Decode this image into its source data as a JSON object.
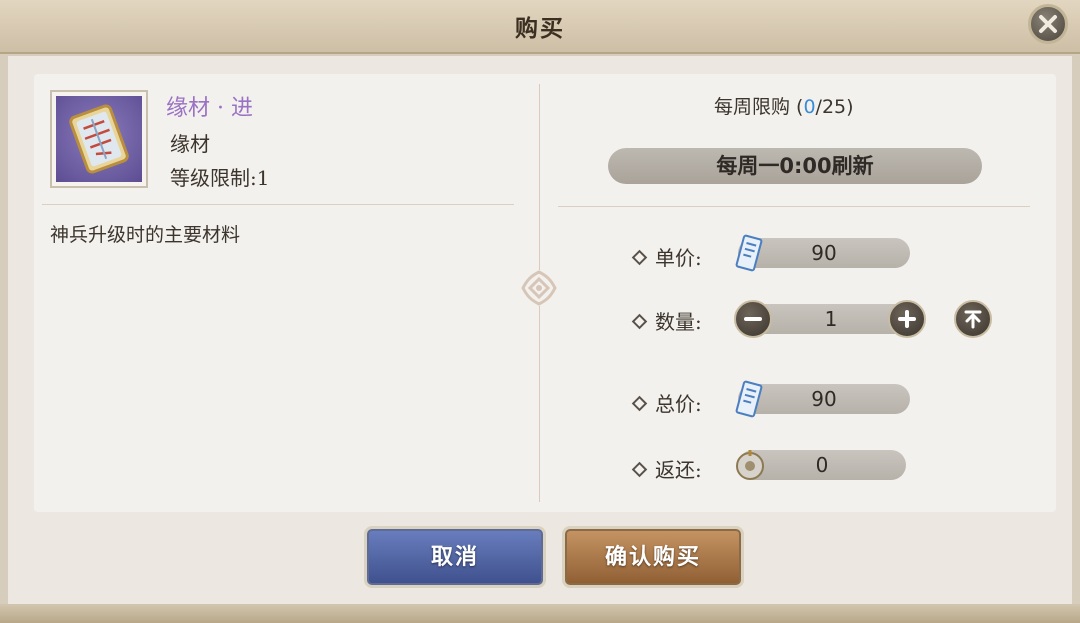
{
  "dialog": {
    "title": "购买"
  },
  "item": {
    "name": "缘材 · 进",
    "type": "缘材",
    "level_label": "等级限制:",
    "level_value": "1",
    "description": "神兵升级时的主要材料"
  },
  "purchase_limit": {
    "prefix": "每周限购 (",
    "current": "0",
    "suffix": "/25)",
    "refresh_text": "每周一0:00刷新"
  },
  "price": {
    "unit_label": "单价:",
    "unit_value": "90",
    "quantity_label": "数量:",
    "quantity_value": "1",
    "total_label": "总价:",
    "total_value": "90",
    "rebate_label": "返还:",
    "rebate_value": "0"
  },
  "buttons": {
    "cancel": "取消",
    "confirm": "确认购买"
  },
  "icons": {
    "close": "close-icon",
    "item": "material-card-icon",
    "currency": "jade-scroll-icon",
    "rebate_currency": "coin-icon",
    "minus": "minus-icon",
    "plus": "plus-icon",
    "max": "max-icon",
    "ornament": "knot-ornament-icon"
  },
  "colors": {
    "item_name": "#9a72c4",
    "limit_current": "#3a8bd8",
    "cancel_button": "#4b5c9c",
    "confirm_button": "#a8713f"
  }
}
